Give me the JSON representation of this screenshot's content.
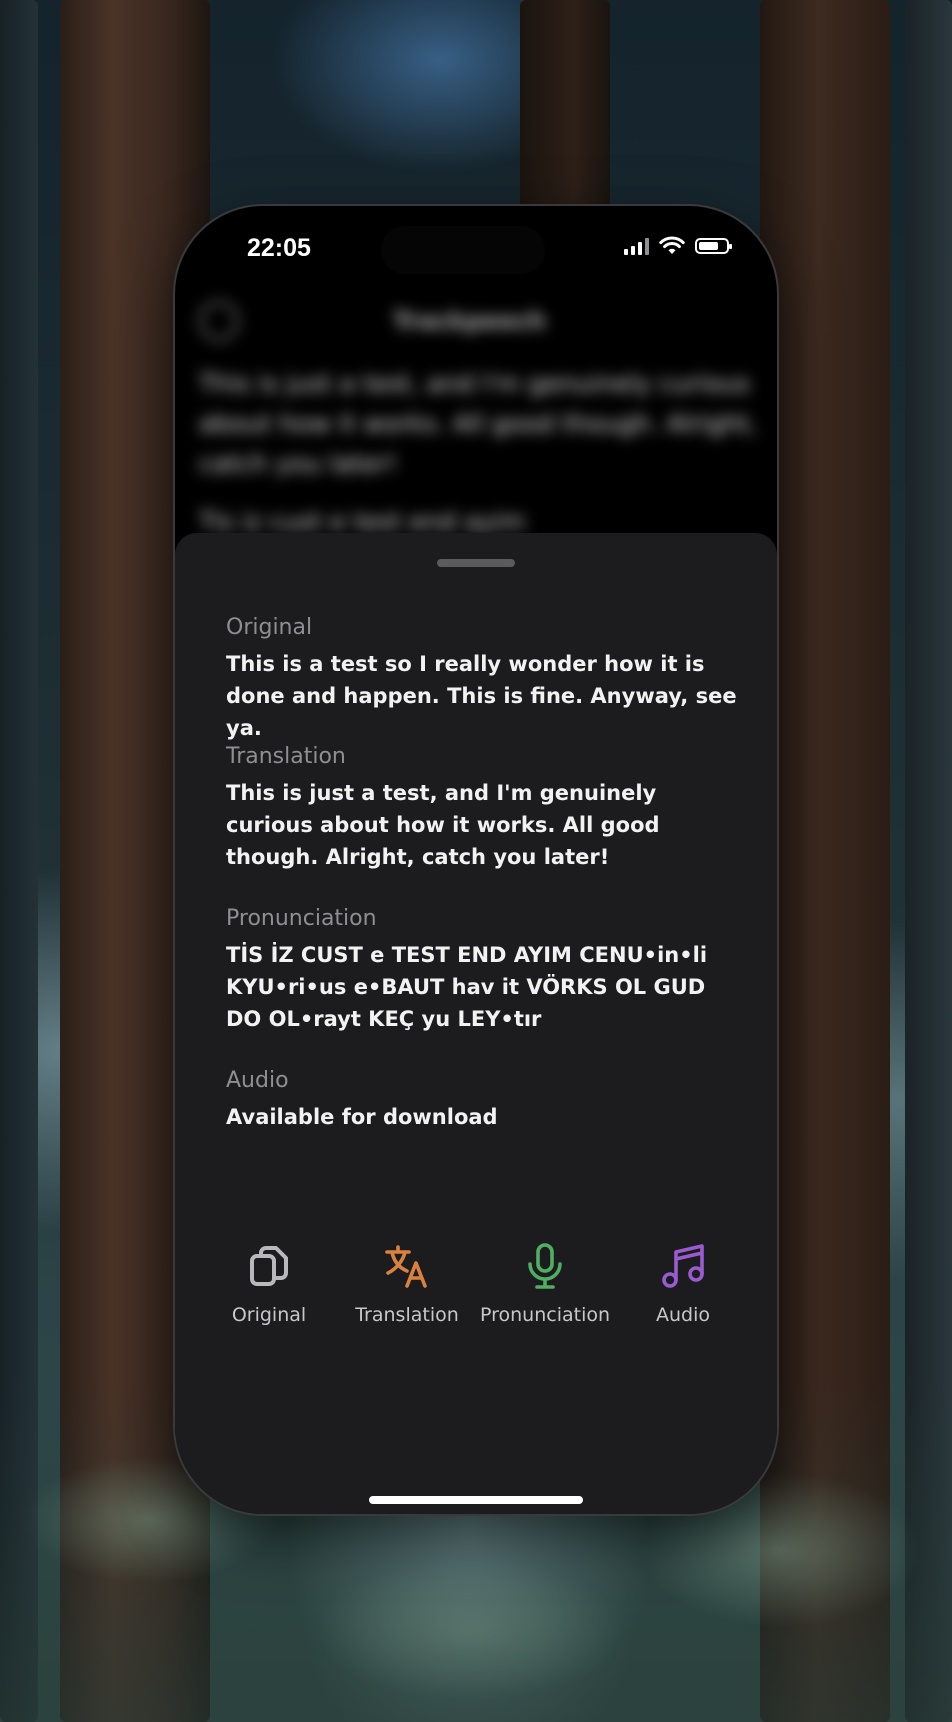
{
  "status_bar": {
    "time": "22:05"
  },
  "background_screen": {
    "title": "Trackpeech",
    "paragraph_1": "This is just a test, and I'm genuinely curious about how it works. All good though. Alright, catch you later!",
    "paragraph_2": "Tis iz cust e test end ayim"
  },
  "sheet": {
    "sections": [
      {
        "label": "Original",
        "body": "This is a test so I really wonder how it is done and happen. This is fine. Anyway, see ya."
      },
      {
        "label": "Translation",
        "body": "This is just a test, and I'm genuinely curious about how it works. All good though. Alright, catch you later!"
      },
      {
        "label": "Pronunciation",
        "body": "TİS İZ CUST e TEST END AYIM CENU•in•li KYU•ri•us e•BAUT hav it VÖRKS OL GUD DO OL•rayt KEÇ yu LEY•tır"
      },
      {
        "label": "Audio",
        "body": "Available for download"
      }
    ]
  },
  "tab_bar": {
    "tabs": [
      {
        "label": "Original",
        "icon": "copy-icon",
        "color": "#b8b8bd"
      },
      {
        "label": "Translation",
        "icon": "translate-icon",
        "color": "#d9823f"
      },
      {
        "label": "Pronunciation",
        "icon": "microphone-icon",
        "color": "#4fae62"
      },
      {
        "label": "Audio",
        "icon": "music-note-icon",
        "color": "#9a5bd0"
      }
    ]
  }
}
